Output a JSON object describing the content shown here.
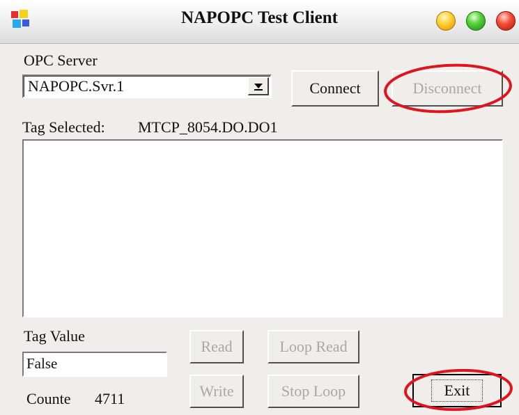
{
  "window": {
    "title": "NAPOPC Test Client",
    "controls": [
      "minimize",
      "maximize",
      "close"
    ]
  },
  "server": {
    "label": "OPC Server",
    "selected": "NAPOPC.Svr.1"
  },
  "buttons": {
    "connect": "Connect",
    "disconnect": "Disconnect",
    "read": "Read",
    "loop_read": "Loop Read",
    "write": "Write",
    "stop_loop": "Stop Loop",
    "exit": "Exit"
  },
  "tag": {
    "selected_label": "Tag Selected:",
    "selected_value": "MTCP_8054.DO.DO1",
    "value_label": "Tag Value",
    "value": "False",
    "counter_label": "Counte",
    "counter_value": "4711"
  },
  "annotations": {
    "highlight_color": "#e0141e",
    "highlighted": [
      "disconnect-button",
      "exit-button"
    ]
  }
}
